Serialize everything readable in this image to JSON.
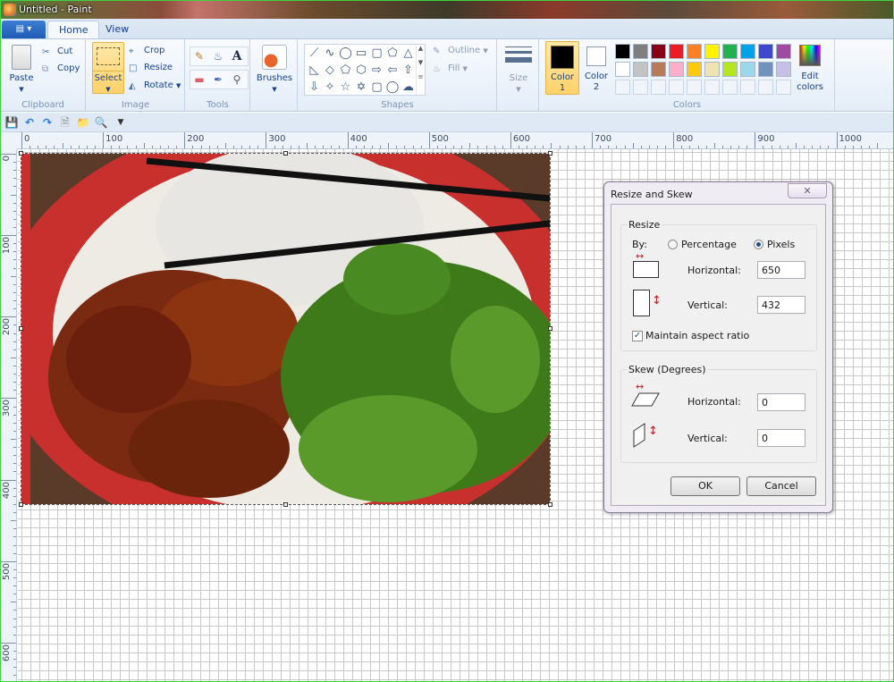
{
  "window": {
    "title": "Untitled - Paint"
  },
  "tabs": [
    {
      "label": "Home",
      "active": true
    },
    {
      "label": "View",
      "active": false
    }
  ],
  "ribbon": {
    "clipboard": {
      "label": "Clipboard",
      "paste": "Paste",
      "cut": "Cut",
      "copy": "Copy"
    },
    "image": {
      "label": "Image",
      "select": "Select",
      "crop": "Crop",
      "resize": "Resize",
      "rotate": "Rotate"
    },
    "tools": {
      "label": "Tools",
      "items": [
        "pencil-icon",
        "fill-icon",
        "text-icon",
        "eraser-icon",
        "color-picker-icon",
        "magnifier-icon"
      ]
    },
    "brushes": {
      "label": "Brushes"
    },
    "shapes": {
      "label": "Shapes",
      "outline": "Outline",
      "fill": "Fill",
      "items": [
        "line",
        "curve",
        "oval",
        "rectangle",
        "rounded-rectangle",
        "polygon",
        "triangle",
        "right-triangle",
        "diamond",
        "pentagon",
        "hexagon",
        "right-arrow",
        "left-arrow",
        "up-arrow",
        "down-arrow",
        "four-point-star",
        "five-point-star",
        "six-point-star",
        "rounded-callout",
        "oval-callout",
        "cloud-callout"
      ]
    },
    "size": {
      "label": "Size"
    },
    "colors": {
      "label": "Colors",
      "color1": {
        "label": "Color",
        "num": "1",
        "value": "#000000"
      },
      "color2": {
        "label": "Color",
        "num": "2",
        "value": "#ffffff"
      },
      "palette_row1": [
        "#000000",
        "#7f7f7f",
        "#880015",
        "#ed1c24",
        "#ff7f27",
        "#fff200",
        "#22b14c",
        "#00a2e8",
        "#3f48cc",
        "#a349a4"
      ],
      "palette_row2": [
        "#ffffff",
        "#c3c3c3",
        "#b97a57",
        "#ffaec9",
        "#ffc90e",
        "#efe4b0",
        "#b5e61d",
        "#99d9ea",
        "#7092be",
        "#c8bfe7"
      ],
      "edit_colors_line1": "Edit",
      "edit_colors_line2": "colors"
    }
  },
  "quick_access": [
    "save-icon",
    "undo-icon",
    "redo-icon",
    "new-icon",
    "open-icon",
    "print-preview-icon",
    "customize-dropdown-icon"
  ],
  "rulers": {
    "horizontal": [
      "0",
      "100",
      "200",
      "300",
      "400",
      "500",
      "600",
      "700",
      "800",
      "900",
      "1000"
    ],
    "vertical": [
      "0",
      "100",
      "200",
      "300",
      "400",
      "500",
      "600"
    ]
  },
  "dialog": {
    "title": "Resize and Skew",
    "close": "✕",
    "resize": {
      "legend": "Resize",
      "by_label": "By:",
      "percentage_label": "Percentage",
      "pixels_label": "Pixels",
      "selected": "Pixels",
      "horizontal_label": "Horizontal:",
      "horizontal_value": "650",
      "vertical_label": "Vertical:",
      "vertical_value": "432",
      "aspect_label": "Maintain aspect ratio",
      "aspect_checked": true
    },
    "skew": {
      "legend": "Skew (Degrees)",
      "horizontal_label": "Horizontal:",
      "horizontal_value": "0",
      "vertical_label": "Vertical:",
      "vertical_value": "0"
    },
    "ok": "OK",
    "cancel": "Cancel"
  }
}
